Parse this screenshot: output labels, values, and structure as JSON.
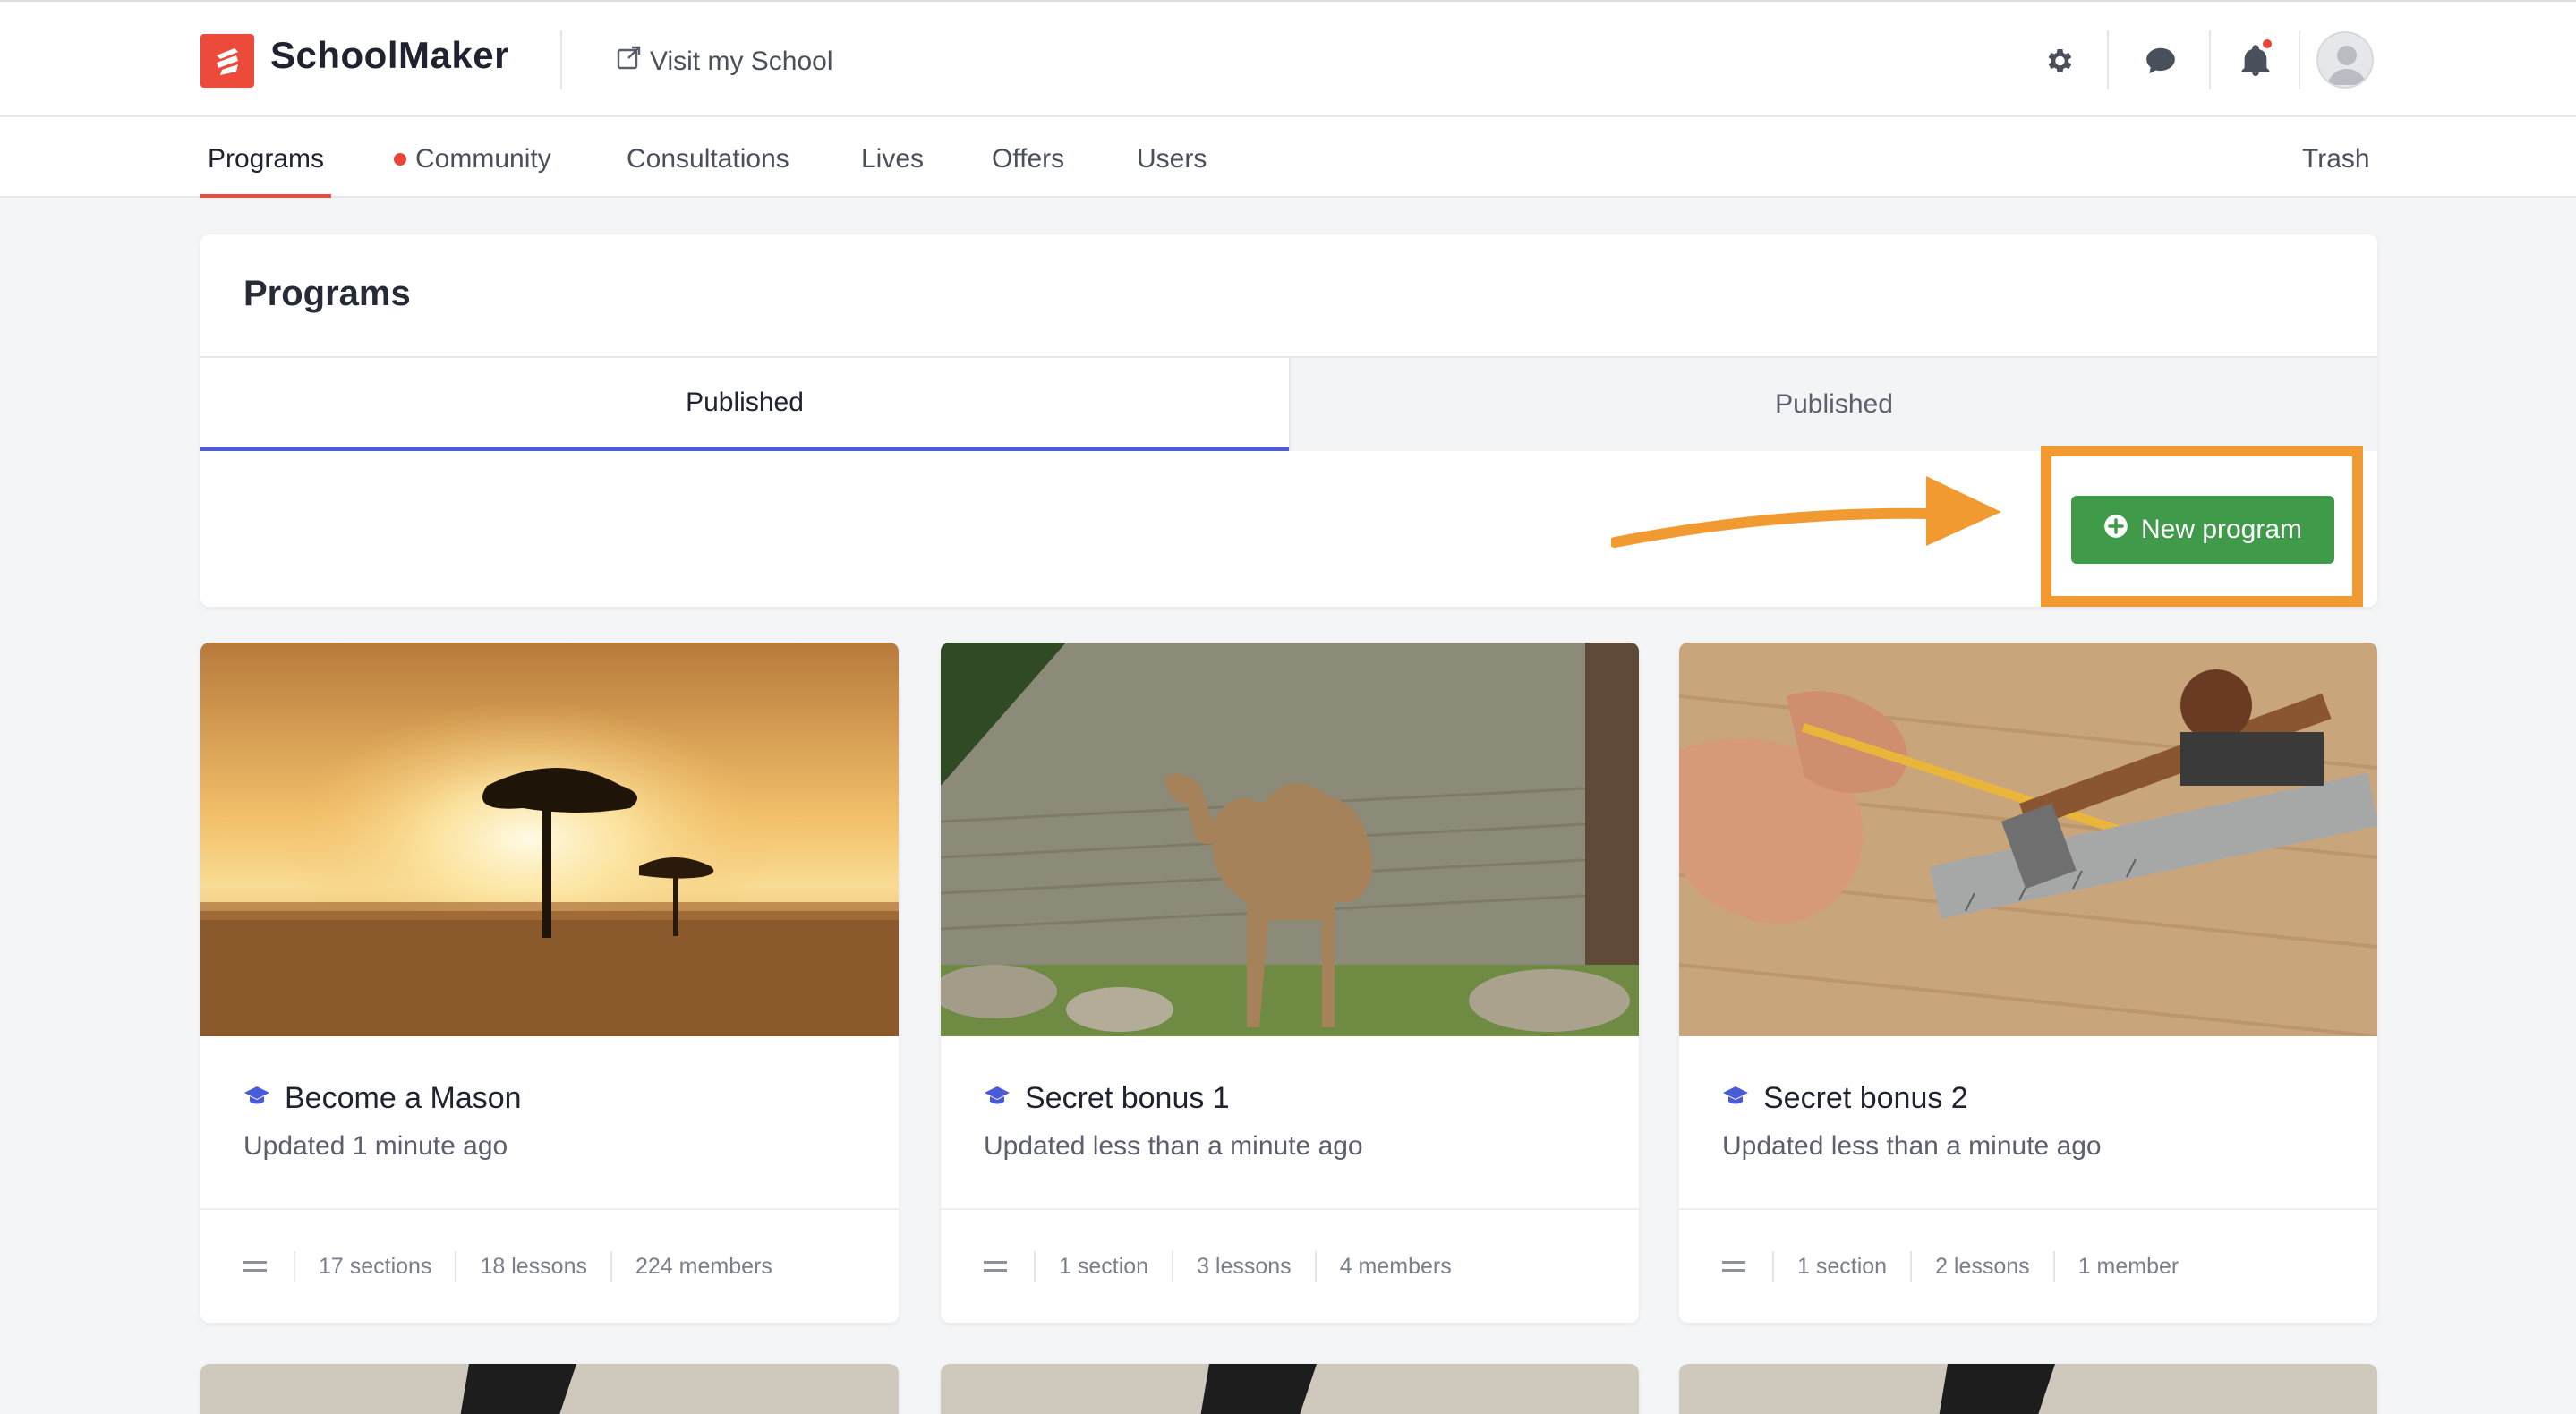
{
  "brand": {
    "name": "SchoolMaker"
  },
  "header": {
    "visit_label": "Visit my School"
  },
  "nav": {
    "items": [
      {
        "label": "Programs"
      },
      {
        "label": "Community"
      },
      {
        "label": "Consultations"
      },
      {
        "label": "Lives"
      },
      {
        "label": "Offers"
      },
      {
        "label": "Users"
      }
    ],
    "trash_label": "Trash"
  },
  "programs": {
    "title": "Programs",
    "tabs": [
      {
        "label": "Published"
      },
      {
        "label": "Published"
      }
    ],
    "new_button_label": "New program"
  },
  "cards": [
    {
      "title": "Become a Mason",
      "updated": "Updated 1 minute ago",
      "sections": "17 sections",
      "lessons": "18 lessons",
      "members": "224 members"
    },
    {
      "title": "Secret bonus 1",
      "updated": "Updated less than a minute ago",
      "sections": "1 section",
      "lessons": "3 lessons",
      "members": "4 members"
    },
    {
      "title": "Secret bonus 2",
      "updated": "Updated less than a minute ago",
      "sections": "1 section",
      "lessons": "2 lessons",
      "members": "1 member"
    }
  ],
  "colors": {
    "brand": "#ec4a3a",
    "tab_active": "#4a5bd8",
    "primary_button": "#3f9b4a",
    "annotation": "#f29a32"
  },
  "icons": [
    "external-link-icon",
    "gear-icon",
    "chat-bubble-icon",
    "bell-icon",
    "avatar-icon",
    "plus-circle-icon",
    "graduation-cap-icon",
    "drag-handle-icon"
  ]
}
